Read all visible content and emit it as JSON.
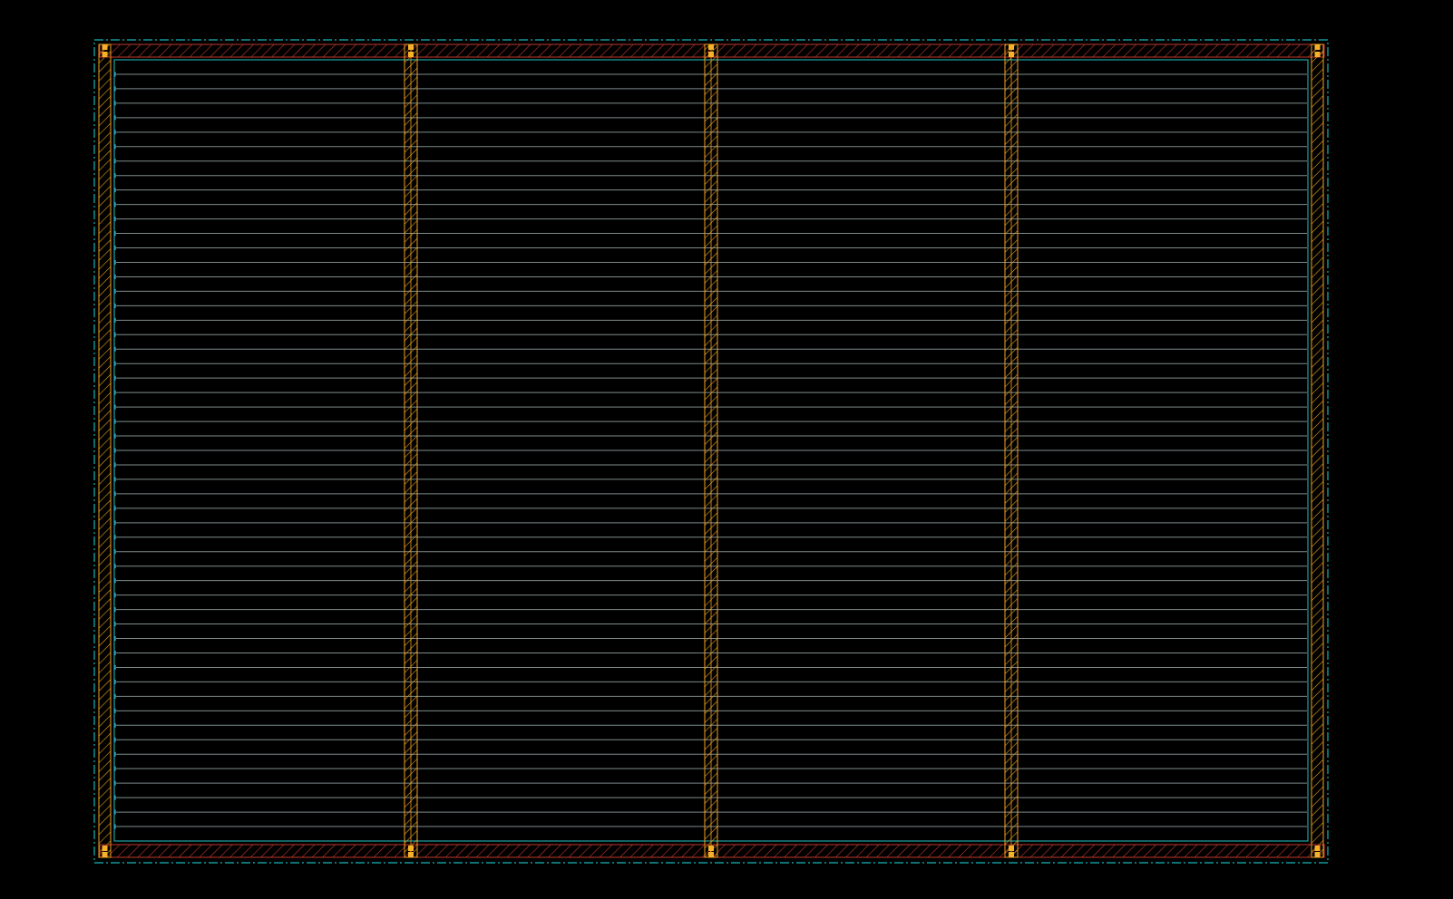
{
  "view": {
    "background": "#000000"
  },
  "colors": {
    "die_boundary": "#16b6b6",
    "core_boundary": "#1fa3a3",
    "row_line": "#7e8c8c",
    "row_tick": "#2aa9c9",
    "power_ring_h": "#c0392b",
    "power_ring_v": "#f0a020",
    "power_stripe": "#f0a020",
    "via": "#f7b02a"
  },
  "layout": {
    "std_cell_rows": 53,
    "power_stripes": 3,
    "stripe_columns": 4
  },
  "layers": [
    {
      "name": "die-area",
      "icon": "dash-dot-rect-icon"
    },
    {
      "name": "core-area",
      "icon": "rect-outline-icon"
    },
    {
      "name": "standard-cell-rows",
      "icon": "horizontal-lines-icon"
    },
    {
      "name": "power-ring",
      "icon": "hatched-ring-icon"
    },
    {
      "name": "power-stripes",
      "icon": "hatched-stripe-icon"
    },
    {
      "name": "vias",
      "icon": "square-icon"
    }
  ]
}
